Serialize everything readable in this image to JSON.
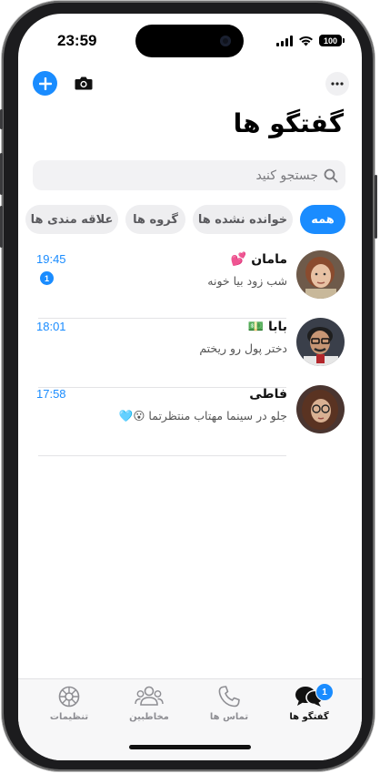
{
  "status_bar": {
    "time": "23:59",
    "battery": "100"
  },
  "top_bar": {
    "new_icon": "plus-icon",
    "camera_icon": "camera-icon",
    "more_icon": "ellipsis-icon"
  },
  "page": {
    "title": "گفتگو ها"
  },
  "search": {
    "placeholder": "جستجو کنید"
  },
  "filters": [
    {
      "label": "همه",
      "active": true
    },
    {
      "label": "خوانده نشده ها",
      "active": false
    },
    {
      "label": "گروه ها",
      "active": false
    },
    {
      "label": "علاقه مندی ها",
      "active": false
    }
  ],
  "chats": [
    {
      "name": "مامان 💕",
      "message": "شب زود بیا خونه",
      "time": "19:45",
      "unread": "1"
    },
    {
      "name": "بابا 💵",
      "message": "دختر پول رو ریختم",
      "time": "18:01",
      "unread": ""
    },
    {
      "name": "فاطی",
      "message": "جلو در سینما مهتاب منتظرتما 😮🩵",
      "time": "17:58",
      "unread": ""
    }
  ],
  "tabbar": {
    "items": [
      {
        "label": "گفتگو ها",
        "icon": "chat-bubbles-icon",
        "badge": "1",
        "active": true
      },
      {
        "label": "تماس ها",
        "icon": "phone-icon",
        "active": false
      },
      {
        "label": "مخاطبین",
        "icon": "contacts-icon",
        "active": false
      },
      {
        "label": "تنظیمات",
        "icon": "gear-icon",
        "active": false
      }
    ]
  },
  "colors": {
    "accent": "#1a8cff",
    "inactive": "#8e8e93"
  }
}
